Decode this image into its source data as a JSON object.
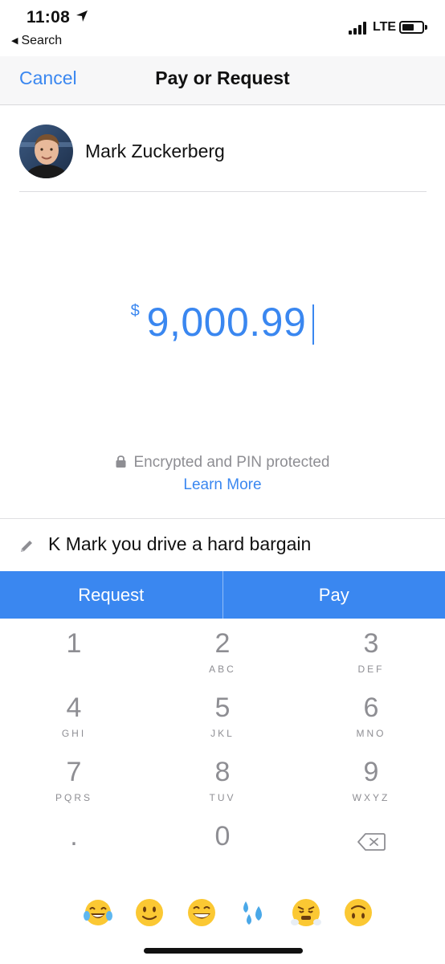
{
  "status_bar": {
    "time": "11:08",
    "back_app": "Search",
    "network": "LTE"
  },
  "nav": {
    "cancel_label": "Cancel",
    "title": "Pay or Request"
  },
  "recipient": {
    "name": "Mark Zuckerberg"
  },
  "amount": {
    "currency_symbol": "$",
    "value": "9,000.99"
  },
  "security": {
    "text": "Encrypted and PIN protected",
    "learn_more": "Learn More"
  },
  "note": {
    "text": "K Mark you drive a hard bargain"
  },
  "actions": {
    "request_label": "Request",
    "pay_label": "Pay"
  },
  "keypad": {
    "keys": [
      {
        "digit": "1",
        "letters": ""
      },
      {
        "digit": "2",
        "letters": "ABC"
      },
      {
        "digit": "3",
        "letters": "DEF"
      },
      {
        "digit": "4",
        "letters": "GHI"
      },
      {
        "digit": "5",
        "letters": "JKL"
      },
      {
        "digit": "6",
        "letters": "MNO"
      },
      {
        "digit": "7",
        "letters": "PQRS"
      },
      {
        "digit": "8",
        "letters": "TUV"
      },
      {
        "digit": "9",
        "letters": "WXYZ"
      },
      {
        "digit": ".",
        "letters": ""
      },
      {
        "digit": "0",
        "letters": ""
      }
    ],
    "backspace_icon": "backspace-icon"
  },
  "emojis": [
    "tears-of-joy",
    "slightly-smiling",
    "grinning-squinting",
    "sweat-droplets",
    "triumph",
    "upside-down"
  ],
  "colors": {
    "accent": "#3a87f0",
    "muted_text": "#8e8e93",
    "nav_background": "#f7f7f8"
  }
}
